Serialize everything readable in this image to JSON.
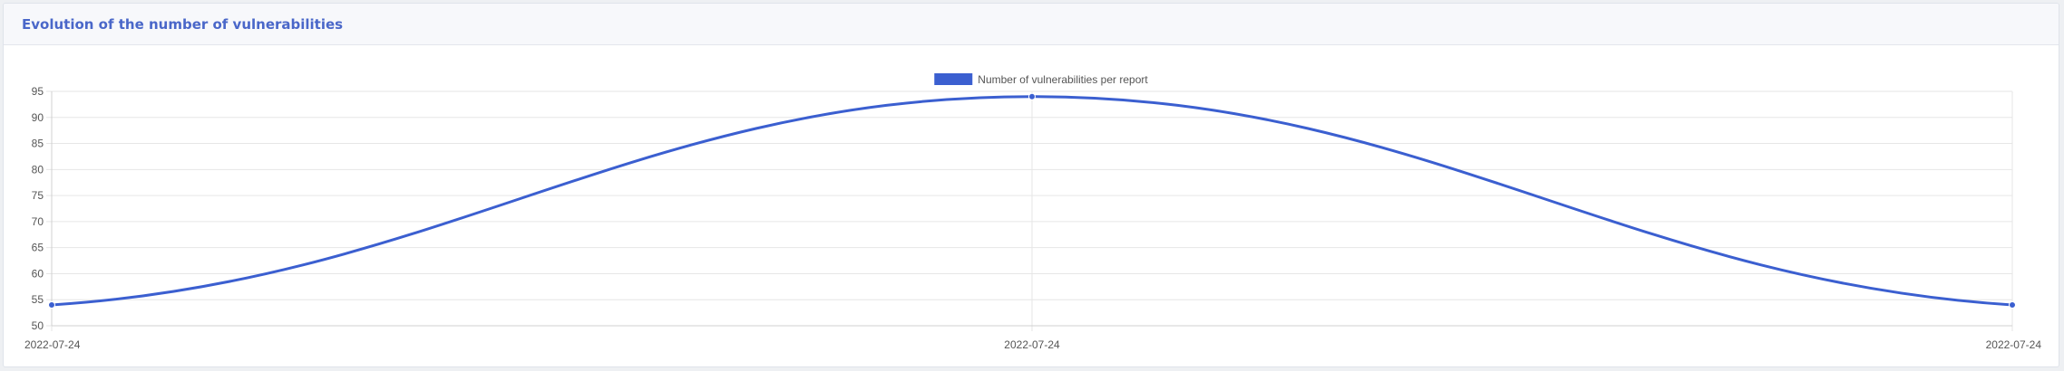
{
  "card": {
    "title": "Evolution of the number of vulnerabilities"
  },
  "colors": {
    "series": "#3b5fd0",
    "grid": "#e6e6e6",
    "tick_text": "#555555",
    "title": "#4a67c9"
  },
  "chart_data": {
    "type": "line",
    "title": "",
    "xlabel": "",
    "ylabel": "",
    "categories": [
      "2022-07-24",
      "2022-07-24",
      "2022-07-24"
    ],
    "series": [
      {
        "name": "Number of vulnerabilities per report",
        "values": [
          54,
          94,
          54
        ]
      }
    ],
    "ylim": [
      50,
      95
    ],
    "yticks": [
      95,
      90,
      85,
      80,
      75,
      70,
      65,
      60,
      55,
      50
    ],
    "grid": true,
    "legend_position": "top"
  }
}
